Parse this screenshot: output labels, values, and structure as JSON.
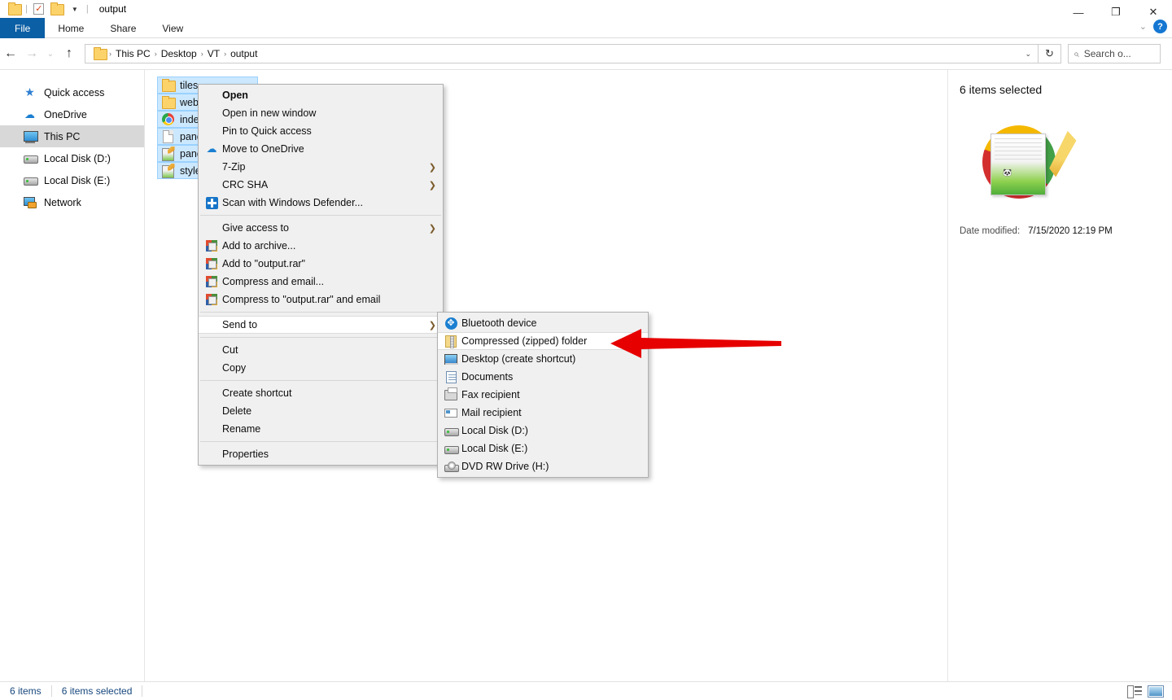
{
  "window": {
    "title": "output",
    "quick_access": [
      {
        "name": "folder-icon",
        "label": "Folder"
      },
      {
        "name": "properties-icon",
        "label": "Properties"
      },
      {
        "name": "new-folder-icon",
        "label": "New folder"
      },
      {
        "name": "customize-caret-icon",
        "label": "Customize Quick Access Toolbar"
      }
    ],
    "controls": {
      "minimize": "—",
      "maximize": "❐",
      "close": "✕"
    }
  },
  "ribbon": {
    "tabs": [
      {
        "label": "File",
        "active": true
      },
      {
        "label": "Home",
        "active": false
      },
      {
        "label": "Share",
        "active": false
      },
      {
        "label": "View",
        "active": false
      }
    ],
    "collapse_caret": "⌄",
    "help": "?"
  },
  "address": {
    "back": "←",
    "forward": "→",
    "recent": "⌄",
    "up": "↑",
    "crumbs": [
      "This PC",
      "Desktop",
      "VT",
      "output"
    ],
    "separator": "›",
    "dropdown_caret": "⌄",
    "refresh": "↻"
  },
  "search": {
    "placeholder": "Search o...",
    "icon": "⌕"
  },
  "sidebar": {
    "items": [
      {
        "label": "Quick access",
        "icon": "star-icon",
        "selected": false
      },
      {
        "label": "OneDrive",
        "icon": "cloud-icon",
        "selected": false
      },
      {
        "label": "This PC",
        "icon": "computer-icon",
        "selected": true
      },
      {
        "label": "Local Disk (D:)",
        "icon": "disk-icon",
        "selected": false
      },
      {
        "label": "Local Disk (E:)",
        "icon": "disk-icon",
        "selected": false
      },
      {
        "label": "Network",
        "icon": "network-icon",
        "selected": false
      }
    ]
  },
  "files": [
    {
      "name": "tiles",
      "icon": "folder-icon",
      "selected": true
    },
    {
      "name": "webx",
      "icon": "folder-icon",
      "selected": true
    },
    {
      "name": "index",
      "icon": "chrome-html-icon",
      "selected": true
    },
    {
      "name": "pand",
      "icon": "generic-file-icon",
      "selected": true
    },
    {
      "name": "pand",
      "icon": "notepadpp-icon",
      "selected": true
    },
    {
      "name": "style",
      "icon": "notepadpp-icon",
      "selected": true
    }
  ],
  "details": {
    "title": "6 items selected",
    "preview_icon": "notepadpp-document-preview",
    "date_modified_label": "Date modified:",
    "date_modified_value": "7/15/2020 12:19 PM"
  },
  "status": {
    "item_count": "6 items",
    "selection": "6 items selected",
    "views": [
      {
        "name": "details-view-button",
        "label": "Details view"
      },
      {
        "name": "large-icons-view-button",
        "label": "Large icons view"
      }
    ]
  },
  "context_menu": {
    "items": [
      {
        "label": "Open",
        "icon": null,
        "bold": true,
        "arrow": false,
        "sep_after": false
      },
      {
        "label": "Open in new window",
        "icon": null,
        "bold": false,
        "arrow": false,
        "sep_after": false
      },
      {
        "label": "Pin to Quick access",
        "icon": null,
        "bold": false,
        "arrow": false,
        "sep_after": false
      },
      {
        "label": "Move to OneDrive",
        "icon": "onedrive-icon",
        "bold": false,
        "arrow": false,
        "sep_after": false
      },
      {
        "label": "7-Zip",
        "icon": null,
        "bold": false,
        "arrow": true,
        "sep_after": false
      },
      {
        "label": "CRC SHA",
        "icon": null,
        "bold": false,
        "arrow": true,
        "sep_after": false
      },
      {
        "label": "Scan with Windows Defender...",
        "icon": "defender-shield-icon",
        "bold": false,
        "arrow": false,
        "sep_after": true
      },
      {
        "label": "Give access to",
        "icon": null,
        "bold": false,
        "arrow": true,
        "sep_after": false
      },
      {
        "label": "Add to archive...",
        "icon": "winrar-icon",
        "bold": false,
        "arrow": false,
        "sep_after": false
      },
      {
        "label": "Add to \"output.rar\"",
        "icon": "winrar-icon",
        "bold": false,
        "arrow": false,
        "sep_after": false
      },
      {
        "label": "Compress and email...",
        "icon": "winrar-icon",
        "bold": false,
        "arrow": false,
        "sep_after": false
      },
      {
        "label": "Compress to \"output.rar\" and email",
        "icon": "winrar-icon",
        "bold": false,
        "arrow": false,
        "sep_after": false
      },
      {
        "label": "Send to",
        "icon": null,
        "bold": false,
        "arrow": true,
        "highlighted": true,
        "sep_after": true
      },
      {
        "label": "Cut",
        "icon": null,
        "bold": false,
        "arrow": false,
        "sep_after": false
      },
      {
        "label": "Copy",
        "icon": null,
        "bold": false,
        "arrow": false,
        "sep_after": true
      },
      {
        "label": "Create shortcut",
        "icon": null,
        "bold": false,
        "arrow": false,
        "sep_after": false
      },
      {
        "label": "Delete",
        "icon": null,
        "bold": false,
        "arrow": false,
        "sep_after": false
      },
      {
        "label": "Rename",
        "icon": null,
        "bold": false,
        "arrow": false,
        "sep_after": true
      },
      {
        "label": "Properties",
        "icon": null,
        "bold": false,
        "arrow": false,
        "sep_after": false
      }
    ]
  },
  "send_to_menu": {
    "items": [
      {
        "label": "Bluetooth device",
        "icon": "bluetooth-icon",
        "highlighted": false
      },
      {
        "label": "Compressed (zipped) folder",
        "icon": "zipped-folder-icon",
        "highlighted": true
      },
      {
        "label": "Desktop (create shortcut)",
        "icon": "desktop-icon",
        "highlighted": false
      },
      {
        "label": "Documents",
        "icon": "documents-icon",
        "highlighted": false
      },
      {
        "label": "Fax recipient",
        "icon": "fax-icon",
        "highlighted": false
      },
      {
        "label": "Mail recipient",
        "icon": "mail-icon",
        "highlighted": false
      },
      {
        "label": "Local Disk (D:)",
        "icon": "disk-icon",
        "highlighted": false
      },
      {
        "label": "Local Disk (E:)",
        "icon": "disk-icon",
        "highlighted": false
      },
      {
        "label": "DVD RW Drive (H:)",
        "icon": "dvd-drive-icon",
        "highlighted": false
      }
    ]
  },
  "annotation": {
    "arrow_color": "#e60000",
    "points_to": "Compressed (zipped) folder"
  },
  "colors": {
    "accent": "#0b5fa5",
    "selection": "#cce8ff",
    "menu_bg": "#f0f0f0",
    "status_text": "#17477d"
  }
}
